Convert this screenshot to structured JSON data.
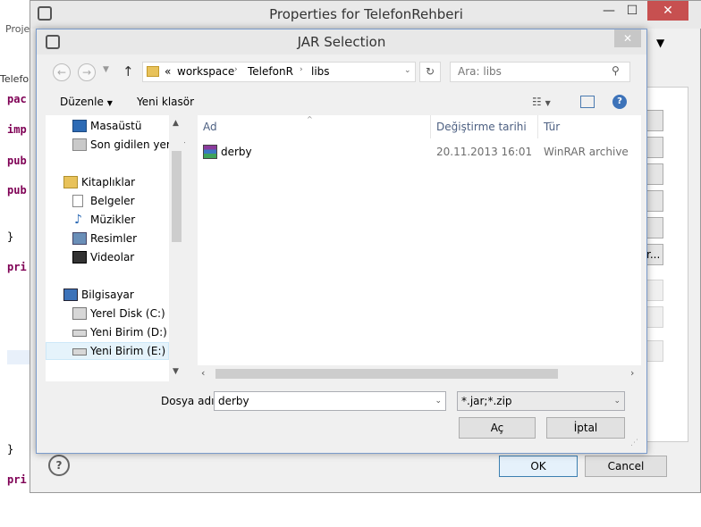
{
  "background": {
    "tab_fragment": "Proje",
    "tab_fragment2": "Telefor",
    "code_lines": [
      "pac",
      "imp",
      "pub",
      "pub",
      "}",
      "pri",
      "}",
      "pri"
    ]
  },
  "props": {
    "title": "Properties for TelefonRehberi",
    "minimize": "—",
    "maximize": "☐",
    "close": "✕",
    "side_button_fragment": "r...",
    "ok": "OK",
    "cancel": "Cancel",
    "help": "?"
  },
  "jar": {
    "title": "JAR Selection",
    "close": "✕",
    "breadcrumb": {
      "chevron": "«",
      "parts": [
        "workspace",
        "TelefonR",
        "libs"
      ]
    },
    "search_placeholder": "Ara: libs",
    "toolbar": {
      "organize": "Düzenle",
      "new_folder": "Yeni klasör"
    },
    "sidebar": [
      {
        "label": "Masaüstü",
        "icon": "desktop-icon"
      },
      {
        "label": "Son gidilen yerler",
        "icon": "recent-places-icon"
      },
      {
        "label": "Kitaplıklar",
        "icon": "libraries-icon"
      },
      {
        "label": "Belgeler",
        "icon": "documents-icon"
      },
      {
        "label": "Müzikler",
        "icon": "music-icon"
      },
      {
        "label": "Resimler",
        "icon": "pictures-icon"
      },
      {
        "label": "Videolar",
        "icon": "videos-icon"
      },
      {
        "label": "Bilgisayar",
        "icon": "computer-icon"
      },
      {
        "label": "Yerel Disk (C:)",
        "icon": "local-disk-icon"
      },
      {
        "label": "Yeni Birim (D:)",
        "icon": "drive-icon"
      },
      {
        "label": "Yeni Birim (E:)",
        "icon": "drive-icon"
      }
    ],
    "columns": [
      "Ad",
      "Değiştirme tarihi",
      "Tür"
    ],
    "files": [
      {
        "name": "derby",
        "modified": "20.11.2013 16:01",
        "type": "WinRAR archive",
        "icon": "winrar-archive-icon"
      }
    ],
    "filename_label": "Dosya adı:",
    "filename_value": "derby",
    "filter_value": "*.jar;*.zip",
    "open": "Aç",
    "cancel": "İptal"
  }
}
